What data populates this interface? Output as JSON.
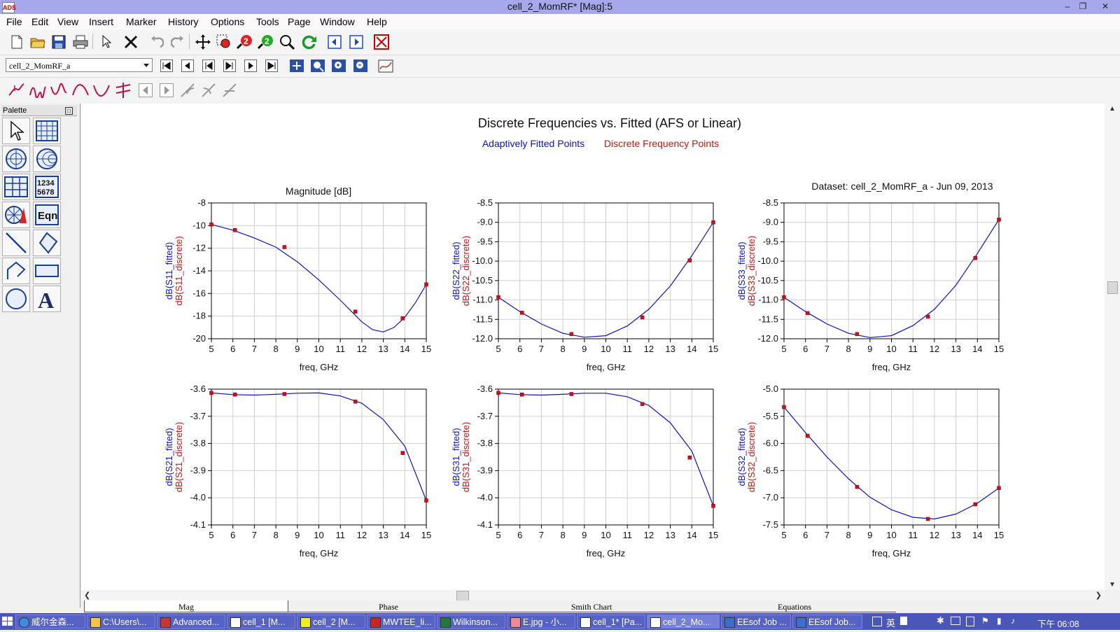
{
  "window": {
    "title": "cell_2_MomRF* [Mag]:5",
    "app_icon": "ads-app-icon"
  },
  "menu": [
    "File",
    "Edit",
    "View",
    "Insert",
    "Marker",
    "History",
    "Options",
    "Tools",
    "Page",
    "Window",
    "Help"
  ],
  "dataset_combo": {
    "value": "cell_2_MomRF_a"
  },
  "palette": {
    "title": "Palette",
    "items": [
      "pointer",
      "rect-plot",
      "polar-plot",
      "smith-chart",
      "stack-table",
      "list-1234",
      "antenna-plot",
      "eqn",
      "line",
      "polygon",
      "polyline",
      "rectangle",
      "circle",
      "text"
    ],
    "list_label": "1234\n5678",
    "eqn_label": "Eqn",
    "text_label": "A"
  },
  "page": {
    "title": "Discrete Frequencies vs. Fitted (AFS or Linear)",
    "legend": [
      {
        "label": "Adaptively Fitted Points",
        "color": "#1010c8"
      },
      {
        "label": "Discrete Frequency Points",
        "color": "#d01010"
      }
    ],
    "subtitle": "Magnitude [dB]",
    "dataset_label": "Dataset: cell_2_MomRF_a - Jun 09, 2013"
  },
  "tabs": [
    "Mag",
    "Phase",
    "Smith Chart",
    "Equations"
  ],
  "taskbar": {
    "items": [
      "威尔金森...",
      "C:\\Users\\...",
      "Advanced...",
      "cell_1 [M...",
      "cell_2 [M...",
      "MWTEE_li...",
      "Wilkinson...",
      "E.jpg - 小...",
      "cell_1* [Pa...",
      "cell_2_Mo...",
      "EEsof Job ...",
      "EEsof Job..."
    ],
    "ime": "英",
    "clock": "下午 06:08"
  },
  "chart_data": [
    {
      "type": "line",
      "name": "S11",
      "xlabel": "freq, GHz",
      "ylabel_fitted": "dB(S11_fitted)",
      "ylabel_discrete": "dB(S11_discrete)",
      "xlim": [
        5,
        15
      ],
      "ylim": [
        -20,
        -8
      ],
      "yticks": [
        -8,
        -10,
        -12,
        -14,
        -16,
        -18,
        -20
      ],
      "ytick_labels": [
        "-8",
        "-10",
        "-12",
        "-14",
        "-16",
        "-18",
        "-20"
      ],
      "fitted": {
        "x": [
          5,
          6,
          7,
          8,
          9,
          10,
          11,
          12,
          12.5,
          13,
          13.5,
          14,
          14.5,
          15
        ],
        "y": [
          -9.9,
          -10.4,
          -11.1,
          -11.9,
          -13.2,
          -14.8,
          -16.6,
          -18.5,
          -19.2,
          -19.4,
          -19.0,
          -18.1,
          -16.8,
          -15.2
        ]
      },
      "discrete": {
        "x": [
          5,
          6.1,
          8.4,
          11.7,
          13.9,
          15
        ],
        "y": [
          -9.9,
          -10.4,
          -11.9,
          -17.6,
          -18.2,
          -15.2
        ]
      }
    },
    {
      "type": "line",
      "name": "S22",
      "xlabel": "freq, GHz",
      "ylabel_fitted": "dB(S22_fitted)",
      "ylabel_discrete": "dB(S22_discrete)",
      "xlim": [
        5,
        15
      ],
      "ylim": [
        -12,
        -8.5
      ],
      "yticks": [
        -8.5,
        -9,
        -9.5,
        -10,
        -10.5,
        -11,
        -11.5,
        -12
      ],
      "ytick_labels": [
        "-8.5",
        "-9.0",
        "-9.5",
        "-10.0",
        "-10.5",
        "-11.0",
        "-11.5",
        "-12.0"
      ],
      "fitted": {
        "x": [
          5,
          6,
          7,
          8,
          9,
          10,
          11,
          12,
          13,
          14,
          15
        ],
        "y": [
          -10.93,
          -11.3,
          -11.62,
          -11.86,
          -11.96,
          -11.92,
          -11.67,
          -11.24,
          -10.64,
          -9.86,
          -9.0
        ]
      },
      "discrete": {
        "x": [
          5,
          6.1,
          8.4,
          11.7,
          13.9,
          15
        ],
        "y": [
          -10.93,
          -11.33,
          -11.88,
          -11.45,
          -9.98,
          -9.0
        ]
      }
    },
    {
      "type": "line",
      "name": "S33",
      "xlabel": "freq, GHz",
      "ylabel_fitted": "dB(S33_fitted)",
      "ylabel_discrete": "dB(S33_discrete)",
      "xlim": [
        5,
        15
      ],
      "ylim": [
        -12,
        -8.5
      ],
      "yticks": [
        -8.5,
        -9,
        -9.5,
        -10,
        -10.5,
        -11,
        -11.5,
        -12
      ],
      "ytick_labels": [
        "-8.5",
        "-9.0",
        "-9.5",
        "-10.0",
        "-10.5",
        "-11.0",
        "-11.5",
        "-12.0"
      ],
      "fitted": {
        "x": [
          5,
          6,
          7,
          8,
          9,
          10,
          11,
          12,
          13,
          14,
          15
        ],
        "y": [
          -10.93,
          -11.3,
          -11.62,
          -11.86,
          -11.97,
          -11.92,
          -11.66,
          -11.24,
          -10.62,
          -9.8,
          -8.93
        ]
      },
      "discrete": {
        "x": [
          5,
          6.1,
          8.4,
          11.7,
          13.9,
          15
        ],
        "y": [
          -10.93,
          -11.34,
          -11.88,
          -11.43,
          -9.92,
          -8.93
        ]
      }
    },
    {
      "type": "line",
      "name": "S21",
      "xlabel": "freq, GHz",
      "ylabel_fitted": "dB(S21_fitted)",
      "ylabel_discrete": "dB(S21_discrete)",
      "xlim": [
        5,
        15
      ],
      "ylim": [
        -4.1,
        -3.6
      ],
      "yticks": [
        -3.6,
        -3.7,
        -3.8,
        -3.9,
        -4.0,
        -4.1
      ],
      "ytick_labels": [
        "-3.6",
        "-3.7",
        "-3.8",
        "-3.9",
        "-4.0",
        "-4.1"
      ],
      "fitted": {
        "x": [
          5,
          6,
          7,
          8,
          9,
          10,
          11,
          12,
          13,
          14,
          15
        ],
        "y": [
          -3.614,
          -3.62,
          -3.622,
          -3.619,
          -3.615,
          -3.614,
          -3.625,
          -3.652,
          -3.712,
          -3.81,
          -4.01
        ]
      },
      "discrete": {
        "x": [
          5,
          6.1,
          8.4,
          11.7,
          13.9,
          15
        ],
        "y": [
          -3.614,
          -3.62,
          -3.618,
          -3.646,
          -3.835,
          -4.01
        ]
      }
    },
    {
      "type": "line",
      "name": "S31",
      "xlabel": "freq, GHz",
      "ylabel_fitted": "dB(S31_fitted)",
      "ylabel_discrete": "dB(S31_discrete)",
      "xlim": [
        5,
        15
      ],
      "ylim": [
        -4.1,
        -3.6
      ],
      "yticks": [
        -3.6,
        -3.7,
        -3.8,
        -3.9,
        -4.0,
        -4.1
      ],
      "ytick_labels": [
        "-3.6",
        "-3.7",
        "-3.8",
        "-3.9",
        "-4.0",
        "-4.1"
      ],
      "fitted": {
        "x": [
          5,
          6,
          7,
          8,
          9,
          10,
          11,
          12,
          13,
          14,
          15
        ],
        "y": [
          -3.614,
          -3.62,
          -3.622,
          -3.619,
          -3.615,
          -3.615,
          -3.628,
          -3.66,
          -3.724,
          -3.828,
          -4.03
        ]
      },
      "discrete": {
        "x": [
          5,
          6.1,
          8.4,
          11.7,
          13.9,
          15
        ],
        "y": [
          -3.614,
          -3.62,
          -3.618,
          -3.655,
          -3.852,
          -4.03
        ]
      }
    },
    {
      "type": "line",
      "name": "S32",
      "xlabel": "freq, GHz",
      "ylabel_fitted": "dB(S32_fitted)",
      "ylabel_discrete": "dB(S32_discrete)",
      "xlim": [
        5,
        15
      ],
      "ylim": [
        -7.5,
        -5.0
      ],
      "yticks": [
        -5,
        -5.5,
        -6,
        -6.5,
        -7,
        -7.5
      ],
      "ytick_labels": [
        "-5.0",
        "-5.5",
        "-6.0",
        "-6.5",
        "-7.0",
        "-7.5"
      ],
      "fitted": {
        "x": [
          5,
          6,
          7,
          8,
          9,
          10,
          11,
          12,
          13,
          14,
          15
        ],
        "y": [
          -5.33,
          -5.8,
          -6.25,
          -6.65,
          -6.99,
          -7.22,
          -7.36,
          -7.39,
          -7.3,
          -7.1,
          -6.82
        ]
      },
      "discrete": {
        "x": [
          5,
          6.1,
          8.4,
          11.7,
          13.9,
          15
        ],
        "y": [
          -5.33,
          -5.86,
          -6.8,
          -7.39,
          -7.12,
          -6.82
        ]
      }
    }
  ]
}
